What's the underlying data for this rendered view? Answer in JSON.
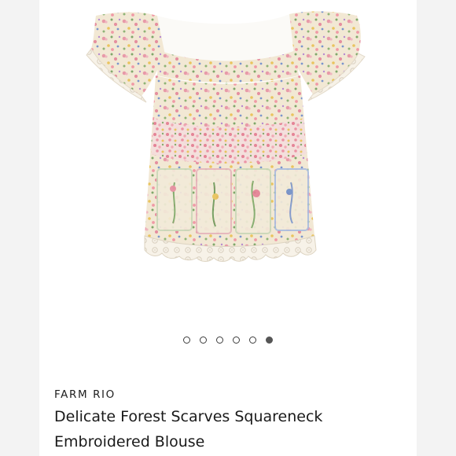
{
  "product": {
    "brand": "FARM RIO",
    "title_line1": "Delicate Forest Scarves Squareneck",
    "title_line2": "Embroidered Blouse"
  },
  "carousel": {
    "total_images": 6,
    "active_index": 6
  },
  "colors": {
    "fabric": "#f3e9d6",
    "lace": "#f6f1e6",
    "accent_pink": "#e58fa0",
    "accent_green": "#6f9e5c",
    "accent_blue": "#6f8fc8",
    "accent_yellow": "#e8c35a"
  }
}
